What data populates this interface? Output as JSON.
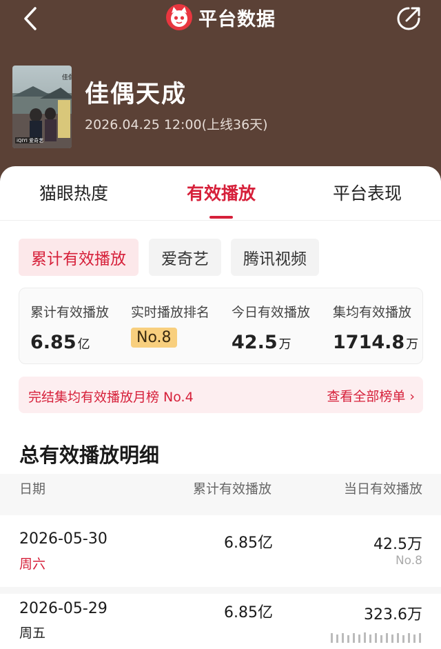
{
  "header": {
    "app_title": "平台数据",
    "drama_title": "佳偶天成",
    "drama_date": "2026.04.25 12:00(上线36天)",
    "poster_label": "iQIYI 爱奇艺",
    "colors": {
      "header_bg": "#5b4136",
      "accent": "#d6203a"
    }
  },
  "tabs": [
    {
      "label": "猫眼热度",
      "active": false
    },
    {
      "label": "有效播放",
      "active": true
    },
    {
      "label": "平台表现",
      "active": false
    }
  ],
  "chips": [
    {
      "label": "累计有效播放",
      "active": true
    },
    {
      "label": "爱奇艺",
      "active": false
    },
    {
      "label": "腾讯视频",
      "active": false
    }
  ],
  "stats": {
    "cumulative": {
      "label": "累计有效播放",
      "value": "6.85",
      "unit": "亿"
    },
    "rank": {
      "label": "实时播放排名",
      "value": "No.8"
    },
    "today": {
      "label": "今日有效播放",
      "value": "42.5",
      "unit": "万"
    },
    "per_episode": {
      "label": "集均有效播放",
      "value": "1714.8",
      "unit": "万"
    }
  },
  "monthly": {
    "text": "完结集均有效播放月榜 No.4",
    "link": "查看全部榜单 ›"
  },
  "details": {
    "title": "总有效播放明细",
    "columns": [
      "日期",
      "累计有效播放",
      "当日有效播放"
    ],
    "rows": [
      {
        "date": "2026-05-30",
        "weekday": "周六",
        "weekday_color": "#d6203a",
        "cumulative": "6.85亿",
        "daily": "42.5万",
        "daily_rank": "No.8"
      },
      {
        "date": "2026-05-29",
        "weekday": "周五",
        "weekday_color": "#222222",
        "cumulative": "6.85亿",
        "daily": "323.6万",
        "daily_rank": ""
      }
    ]
  }
}
